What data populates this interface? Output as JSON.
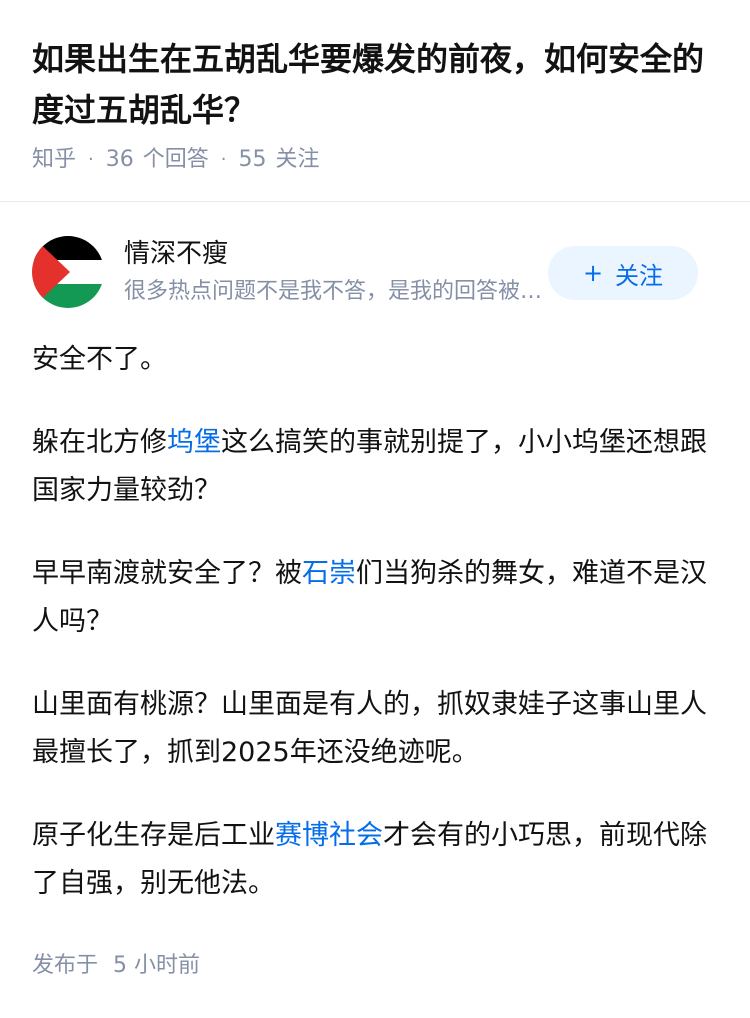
{
  "question": {
    "title": "如果出生在五胡乱华要爆发的前夜，如何安全的度过五胡乱华？",
    "source": "知乎",
    "answer_count": "36",
    "answer_label": "个回答",
    "follower_count": "55",
    "follower_label": "关注"
  },
  "author": {
    "name": "情深不瘦",
    "bio": "很多热点问题不是我不答，是我的回答被删了…",
    "avatar_icon": "palestine-flag-icon",
    "follow_label": "关注",
    "colors": {
      "black": "#000000",
      "white": "#ffffff",
      "green": "#149954",
      "red": "#e4312b"
    }
  },
  "answer": {
    "p1": "安全不了。",
    "p2_a": "躲在北方修",
    "p2_link": "坞堡",
    "p2_b": "这么搞笑的事就别提了，小小坞堡还想跟国家力量较劲？",
    "p3_a": "早早南渡就安全了？被",
    "p3_link": "石崇",
    "p3_b": "们当狗杀的舞女，难道不是汉人吗？",
    "p4": "山里面有桃源？山里面是有人的，抓奴隶娃子这事山里人最擅长了，抓到2025年还没绝迹呢。",
    "p5_a": "原子化生存是后工业",
    "p5_link": "赛博社会",
    "p5_b": "才会有的小巧思，前现代除了自强，别无他法。",
    "publish_label": "发布于",
    "publish_time": "5 小时前"
  },
  "theme": {
    "link_color": "#056de8",
    "meta_color": "#8590a6"
  }
}
